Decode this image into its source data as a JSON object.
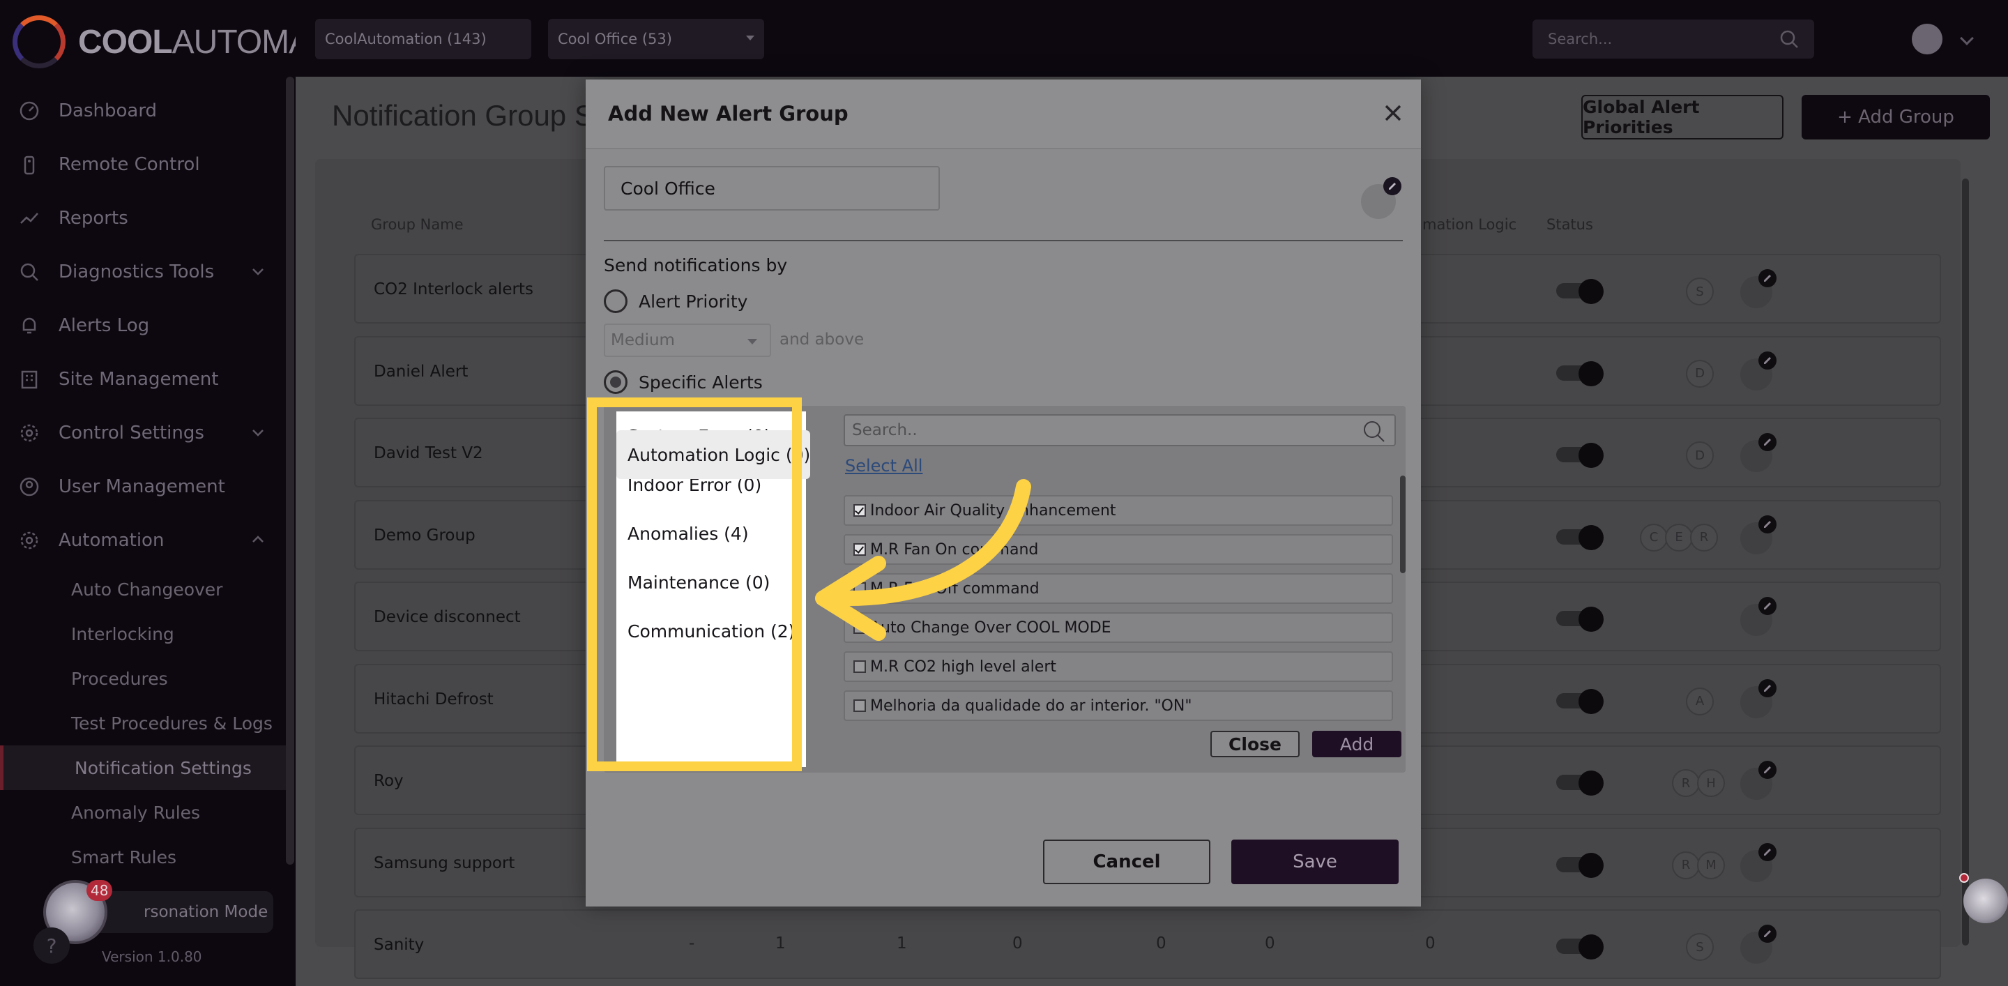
{
  "brand": {
    "name_left": "COOL",
    "name_right": "AUTOMATION"
  },
  "sidebar": {
    "items": [
      {
        "label": "Dashboard",
        "icon": "dashboard-icon"
      },
      {
        "label": "Remote Control",
        "icon": "remote-icon"
      },
      {
        "label": "Reports",
        "icon": "chart-line-icon"
      },
      {
        "label": "Diagnostics Tools",
        "icon": "search-icon",
        "expandable": true
      },
      {
        "label": "Alerts Log",
        "icon": "bell-icon"
      },
      {
        "label": "Site Management",
        "icon": "building-icon"
      },
      {
        "label": "Control Settings",
        "icon": "gear-icon",
        "expandable": true
      },
      {
        "label": "User Management",
        "icon": "user-icon"
      },
      {
        "label": "Automation",
        "icon": "gear-icon",
        "expanded": true
      }
    ],
    "sub_items": [
      {
        "label": "Auto Changeover"
      },
      {
        "label": "Interlocking"
      },
      {
        "label": "Procedures"
      },
      {
        "label": "Test Procedures & Logs"
      },
      {
        "label": "Notification Settings",
        "active": true
      },
      {
        "label": "Anomaly Rules"
      },
      {
        "label": "Smart Rules"
      }
    ],
    "impersonation": {
      "badge": "48",
      "label": "rsonation Mode"
    },
    "help": "?",
    "version": "Version 1.0.80"
  },
  "topbar": {
    "customer_select": "CoolAutomation (143)",
    "site_select": "Cool Office (53)",
    "search_placeholder": "Search..."
  },
  "page": {
    "title": "Notification Group S",
    "global_priorities_btn": "Global Alert Priorities",
    "add_group_btn": "+ Add Group",
    "columns": {
      "group_name": "Group Name",
      "automation_logic": "mation Logic",
      "status": "Status"
    },
    "rows": [
      {
        "name": "CO2 Interlock alerts",
        "chips": [
          "S"
        ]
      },
      {
        "name": "Daniel Alert",
        "chips": [
          "D"
        ]
      },
      {
        "name": "David Test V2",
        "chips": [
          "D"
        ]
      },
      {
        "name": "Demo Group",
        "chips": [
          "C",
          "E",
          "R"
        ]
      },
      {
        "name": "Device disconnect",
        "chips": []
      },
      {
        "name": "Hitachi Defrost",
        "chips": [
          "A"
        ]
      },
      {
        "name": "Roy",
        "chips": [
          "R",
          "H"
        ]
      },
      {
        "name": "Samsung support",
        "chips": [
          "R",
          "M"
        ]
      },
      {
        "name": "Sanity",
        "chips": [
          "S"
        ]
      }
    ],
    "partial_row_values": [
      "-",
      "1",
      "1",
      "0",
      "0",
      "0",
      "0"
    ]
  },
  "modal": {
    "title": "Add New Alert Group",
    "group_name_value": "Cool Office",
    "send_by_label": "Send notifications by",
    "option_priority": "Alert Priority",
    "priority_value": "Medium",
    "and_above": "and above",
    "option_specific": "Specific Alerts",
    "categories": [
      {
        "label": "System Error (0)"
      },
      {
        "label": "Indoor Error (0)"
      },
      {
        "label": "Anomalies (4)"
      },
      {
        "label": "Maintenance (0)"
      },
      {
        "label": "Communication (2)"
      },
      {
        "label": "Automation Logic (0)",
        "selected": true
      }
    ],
    "search_placeholder": "Search..",
    "select_all": "Select All",
    "alerts": [
      {
        "label": "Indoor Air Quality Enhancement",
        "checked": true
      },
      {
        "label": "M.R Fan On command",
        "checked": true
      },
      {
        "label": "M.R Fan Off command",
        "checked": false
      },
      {
        "label": "Auto Change Over COOL MODE",
        "checked": false
      },
      {
        "label": "M.R CO2 high level alert",
        "checked": false
      },
      {
        "label": "Melhoria da qualidade do ar interior. \"ON\"",
        "checked": false
      }
    ],
    "close_btn": "Close",
    "add_btn": "Add",
    "cancel_btn": "Cancel",
    "save_btn": "Save"
  },
  "colors": {
    "highlight": "#fdd244",
    "accent_dark": "#1f0f24",
    "badge": "#b2293a"
  }
}
